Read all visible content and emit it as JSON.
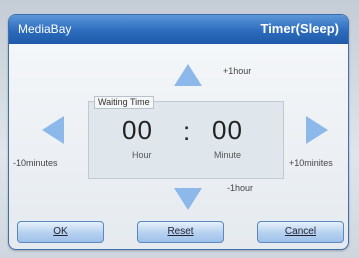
{
  "header": {
    "app_name": "MediaBay",
    "title": "Timer(Sleep)"
  },
  "timer": {
    "label": "Waiting Time",
    "hour": "00",
    "separator": ":",
    "minute": "00",
    "hour_unit": "Hour",
    "minute_unit": "Minute"
  },
  "controls": {
    "up_hint": "+1hour",
    "down_hint": "-1hour",
    "left_hint": "-10minutes",
    "right_hint": "+10minites"
  },
  "buttons": {
    "ok": "OK",
    "reset": "Reset",
    "cancel": "Cancel"
  },
  "colors": {
    "title_bar": "#2c6bbd",
    "arrow": "#8cb9ea",
    "button": "#b6d1f0"
  }
}
